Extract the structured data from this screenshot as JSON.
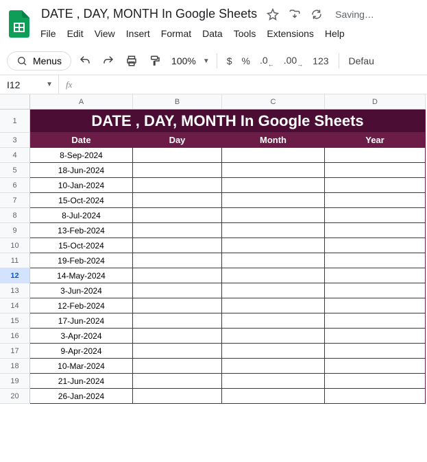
{
  "doc": {
    "title": "DATE , DAY, MONTH  In Google Sheets",
    "saving": "Saving…"
  },
  "menubar": [
    "File",
    "Edit",
    "View",
    "Insert",
    "Format",
    "Data",
    "Tools",
    "Extensions",
    "Help"
  ],
  "toolbar": {
    "menus": "Menus",
    "zoom": "100%",
    "currency": "$",
    "percent": "%",
    "dec_dec": ".0",
    "dec_inc": ".00",
    "num123": "123",
    "font_trunc": "Defau"
  },
  "namebox": "I12",
  "columns": [
    "A",
    "B",
    "C",
    "D"
  ],
  "banner_text": "DATE , DAY, MONTH  In Google Sheets",
  "table_headers": {
    "date": "Date",
    "day": "Day",
    "month": "Month",
    "year": "Year"
  },
  "row_numbers": [
    "1",
    "3",
    "4",
    "5",
    "6",
    "7",
    "8",
    "9",
    "10",
    "11",
    "12",
    "13",
    "14",
    "15",
    "16",
    "17",
    "18",
    "19",
    "20"
  ],
  "active_row": "12",
  "dates": [
    "8-Sep-2024",
    "18-Jun-2024",
    "10-Jan-2024",
    "15-Oct-2024",
    "8-Jul-2024",
    "13-Feb-2024",
    "15-Oct-2024",
    "19-Feb-2024",
    "14-May-2024",
    "3-Jun-2024",
    "12-Feb-2024",
    "17-Jun-2024",
    "3-Apr-2024",
    "9-Apr-2024",
    "10-Mar-2024",
    "21-Jun-2024",
    "26-Jan-2024"
  ]
}
